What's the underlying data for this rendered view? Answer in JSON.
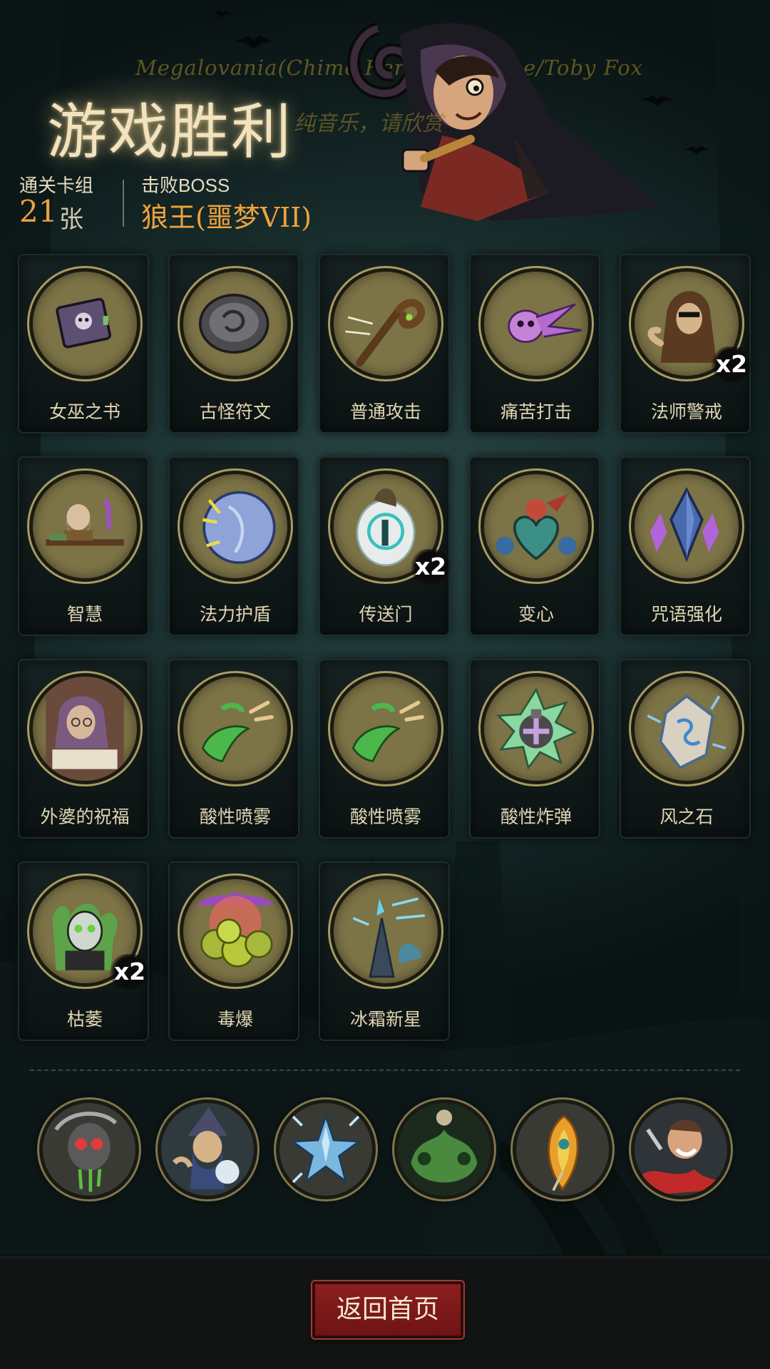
{
  "header": {
    "track_title": "Megalovania(Chime Remix) - Chime/Toby Fox",
    "track_subtitle": "纯音乐，请欣赏",
    "victory_title": "游戏胜利",
    "deck_label": "通关卡组",
    "deck_count": "21",
    "deck_unit": "张",
    "boss_label": "击败BOSS",
    "boss_name": "狼王(噩梦VII)"
  },
  "cards": [
    {
      "label": "女巫之书",
      "icon": "witch-book-icon",
      "count": ""
    },
    {
      "label": "古怪符文",
      "icon": "strange-rune-icon",
      "count": ""
    },
    {
      "label": "普通攻击",
      "icon": "staff-attack-icon",
      "count": ""
    },
    {
      "label": "痛苦打击",
      "icon": "pain-strike-icon",
      "count": ""
    },
    {
      "label": "法师警戒",
      "icon": "mage-alert-icon",
      "count": "x2"
    },
    {
      "label": "智慧",
      "icon": "wisdom-icon",
      "count": ""
    },
    {
      "label": "法力护盾",
      "icon": "mana-shield-icon",
      "count": ""
    },
    {
      "label": "传送门",
      "icon": "portal-icon",
      "count": "x2"
    },
    {
      "label": "变心",
      "icon": "change-heart-icon",
      "count": ""
    },
    {
      "label": "咒语强化",
      "icon": "spell-crystal-icon",
      "count": ""
    },
    {
      "label": "外婆的祝福",
      "icon": "grandma-blessing-icon",
      "count": ""
    },
    {
      "label": "酸性喷雾",
      "icon": "acid-spray-icon",
      "count": ""
    },
    {
      "label": "酸性喷雾",
      "icon": "acid-spray-icon",
      "count": ""
    },
    {
      "label": "酸性炸弹",
      "icon": "acid-bomb-icon",
      "count": ""
    },
    {
      "label": "风之石",
      "icon": "wind-stone-icon",
      "count": ""
    },
    {
      "label": "枯萎",
      "icon": "wither-icon",
      "count": "x2"
    },
    {
      "label": "毒爆",
      "icon": "poison-burst-icon",
      "count": ""
    },
    {
      "label": "冰霜新星",
      "icon": "frost-nova-icon",
      "count": ""
    }
  ],
  "relics": [
    {
      "icon": "reaper-skull-relic-icon"
    },
    {
      "icon": "wizard-relic-icon"
    },
    {
      "icon": "ice-star-relic-icon"
    },
    {
      "icon": "ghost-skull-relic-icon"
    },
    {
      "icon": "phoenix-feather-relic-icon"
    },
    {
      "icon": "mad-warrior-relic-icon"
    }
  ],
  "footer": {
    "home_button_label": "返回首页"
  },
  "colors": {
    "accent_orange": "#eea33c",
    "button_red": "#7e1a1a",
    "medallion_olive": "#7c7346"
  }
}
